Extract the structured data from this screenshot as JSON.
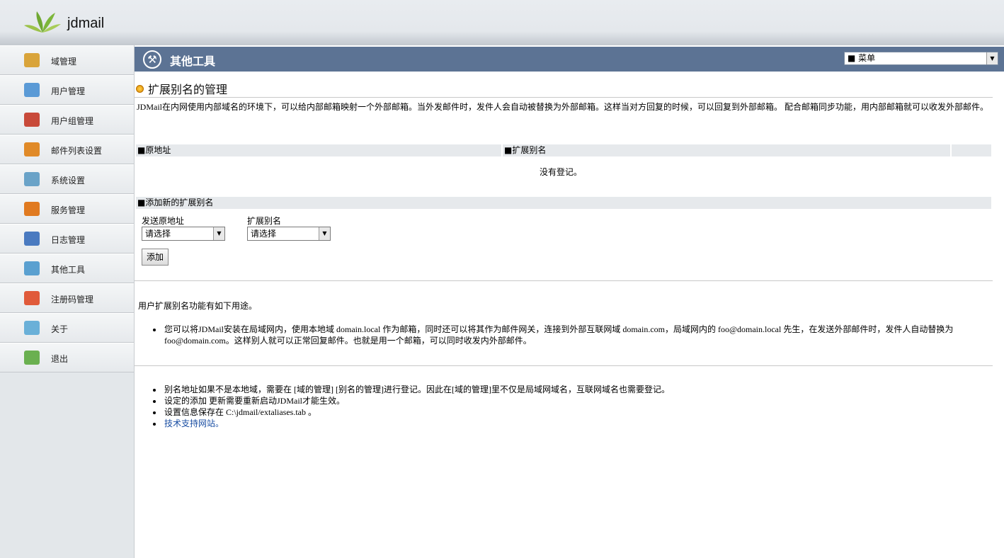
{
  "app": {
    "logo_text": "jdmail"
  },
  "sidebar": {
    "items": [
      {
        "label": "域管理",
        "icon": "domain-icon",
        "color": "#d9a43a"
      },
      {
        "label": "用户管理",
        "icon": "user-icon",
        "color": "#5a9ad6"
      },
      {
        "label": "用户组管理",
        "icon": "users-group-icon",
        "color": "#c84a3a"
      },
      {
        "label": "邮件列表设置",
        "icon": "mail-list-icon",
        "color": "#e08a28"
      },
      {
        "label": "系统设置",
        "icon": "system-icon",
        "color": "#6aa3c8"
      },
      {
        "label": "服务管理",
        "icon": "service-icon",
        "color": "#e07a20"
      },
      {
        "label": "日志管理",
        "icon": "log-icon",
        "color": "#4a7ac0"
      },
      {
        "label": "其他工具",
        "icon": "tools-icon",
        "color": "#5aa0d0"
      },
      {
        "label": "注册码管理",
        "icon": "license-icon",
        "color": "#e05a3a"
      },
      {
        "label": "关于",
        "icon": "about-icon",
        "color": "#6ab0d8"
      },
      {
        "label": "退出",
        "icon": "logout-icon",
        "color": "#6ab050"
      }
    ]
  },
  "titlebar": {
    "title": "其他工具",
    "menu_value": "■ 菜单"
  },
  "section": {
    "title": "扩展别名的管理",
    "description": "JDMail在内网使用内部域名的环境下，可以给内部邮箱映射一个外部邮箱。当外发邮件时，发件人会自动被替换为外部邮箱。这样当对方回复的时候，可以回复到外部邮箱。 配合邮箱同步功能，用内部邮箱就可以收发外部邮件。"
  },
  "table": {
    "headers": [
      "■原地址",
      "■扩展别名"
    ],
    "empty_text": "没有登记。"
  },
  "add_form": {
    "heading": "■添加新的扩展别名",
    "source_label": "发送原地址",
    "source_value": "请选择",
    "alias_label": "扩展别名",
    "alias_value": "请选择",
    "add_button": "添加"
  },
  "usage": {
    "intro": "用户扩展别名功能有如下用途。",
    "item": "您可以将JDMail安装在局域网内，使用本地域 domain.local 作为邮箱，同时还可以将其作为邮件网关，连接到外部互联网域 domain.com，局域网内的 foo@domain.local 先生，在发送外部邮件时，发件人自动替换为 foo@domain.com。这样别人就可以正常回复邮件。也就是用一个邮箱，可以同时收发内外部邮件。"
  },
  "notes": {
    "items": [
      "别名地址如果不是本地域，需要在 [域的管理] [别名的管理]进行登记。因此在[域的管理]里不仅是局域网域名，互联网域名也需要登记。",
      "设定的添加 更新需要重新启动JDMail才能生效。",
      "设置信息保存在 C:\\jdmail/extaliases.tab 。"
    ],
    "link": "技术支持网站。"
  }
}
